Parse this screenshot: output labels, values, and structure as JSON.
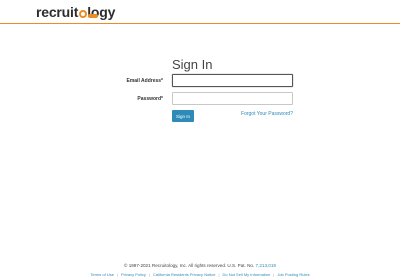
{
  "header": {
    "logo_text_left": "recruit",
    "logo_text_right": "logy",
    "brand_color": "#f08a24"
  },
  "signin": {
    "title": "Sign In",
    "email_label": "Email Address*",
    "email_value": "",
    "password_label": "Password*",
    "password_value": "",
    "button_label": "Sign In",
    "forgot_link": "Forgot Your Password?",
    "button_color": "#2e8bb8"
  },
  "footer": {
    "copyright": "© 1997-2021 Recruitology, Inc. All rights reserved. U.S. Pat. No.",
    "patent_number": "7,213,019",
    "links": [
      "Terms of Use",
      "Privacy Policy",
      "California Residents Privacy Notice",
      "Do Not Sell My Information",
      "Job Posting Rules"
    ],
    "link_color": "#2e8bb8"
  }
}
